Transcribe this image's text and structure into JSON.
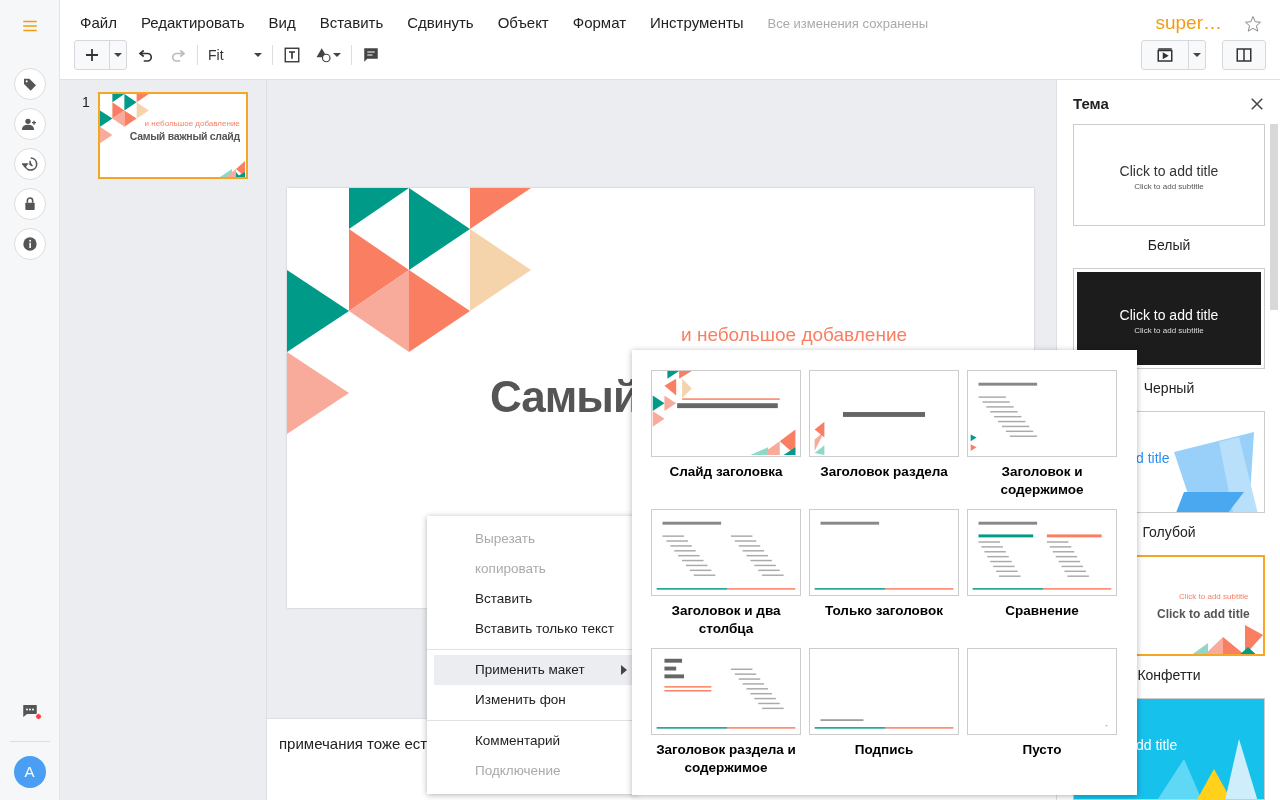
{
  "app": {
    "title": "super…",
    "starred": false
  },
  "menu": [
    "Файл",
    "Редактировать",
    "Вид",
    "Вставить",
    "Сдвинуть",
    "Объект",
    "Формат",
    "Инструменты"
  ],
  "save_status": "Все изменения сохранены",
  "toolbar": {
    "zoom": "Fit",
    "redo_disabled": true
  },
  "rail": {
    "avatar": "A",
    "chat_unread": true
  },
  "slides": [
    {
      "number": "1",
      "selected": true,
      "subtitle": "и небольшое добавление",
      "title": "Самый важный слайд"
    }
  ],
  "canvas": {
    "subtitle": "и небольшое добавление",
    "title": "Самый"
  },
  "notes": "примечания тоже ест",
  "context_menu": [
    {
      "kind": "item",
      "label": "Вырезать",
      "disabled": true,
      "highlighted": false,
      "has_submenu": false
    },
    {
      "kind": "item",
      "label": "копировать",
      "disabled": true,
      "highlighted": false,
      "has_submenu": false
    },
    {
      "kind": "item",
      "label": "Вставить",
      "disabled": false,
      "highlighted": false,
      "has_submenu": false
    },
    {
      "kind": "item",
      "label": "Вставить только текст",
      "disabled": false,
      "highlighted": false,
      "has_submenu": false
    },
    {
      "kind": "separator"
    },
    {
      "kind": "item",
      "label": "Применить макет",
      "disabled": false,
      "highlighted": true,
      "has_submenu": true
    },
    {
      "kind": "item",
      "label": "Изменить фон",
      "disabled": false,
      "highlighted": false,
      "has_submenu": false
    },
    {
      "kind": "separator"
    },
    {
      "kind": "item",
      "label": "Комментарий",
      "disabled": false,
      "highlighted": false,
      "has_submenu": false
    },
    {
      "kind": "item",
      "label": "Подключение",
      "disabled": true,
      "highlighted": false,
      "has_submenu": false
    }
  ],
  "layouts": [
    {
      "kind": "title",
      "label": "Слайд заголовка"
    },
    {
      "kind": "section",
      "label": "Заголовок раздела"
    },
    {
      "kind": "content",
      "label": "Заголовок и содержимое"
    },
    {
      "kind": "two_columns",
      "label": "Заголовок и два столбца"
    },
    {
      "kind": "title_only",
      "label": "Только заголовок"
    },
    {
      "kind": "comparison",
      "label": "Сравнение"
    },
    {
      "kind": "section_content",
      "label": "Заголовок раздела и содержимое"
    },
    {
      "kind": "caption",
      "label": "Подпись"
    },
    {
      "kind": "blank",
      "label": "Пусто"
    }
  ],
  "theme_panel": {
    "title": "Тема",
    "themes": [
      {
        "kind": "white",
        "name": "Белый",
        "selected": false,
        "preview_title": "Click to add title",
        "preview_subtitle": "Click to add subtitle"
      },
      {
        "kind": "black",
        "name": "Черный",
        "selected": false,
        "preview_title": "Click to add title",
        "preview_subtitle": "Click to add subtitle"
      },
      {
        "kind": "blue",
        "name": "Голубой",
        "selected": false,
        "preview_title": "d title"
      },
      {
        "kind": "confetti",
        "name": "Конфетти",
        "selected": true,
        "preview_title": "Click to add title",
        "preview_subtitle": "Click to add subtitle"
      },
      {
        "kind": "cyan",
        "selected": false,
        "preview_title": "dd title"
      }
    ]
  }
}
